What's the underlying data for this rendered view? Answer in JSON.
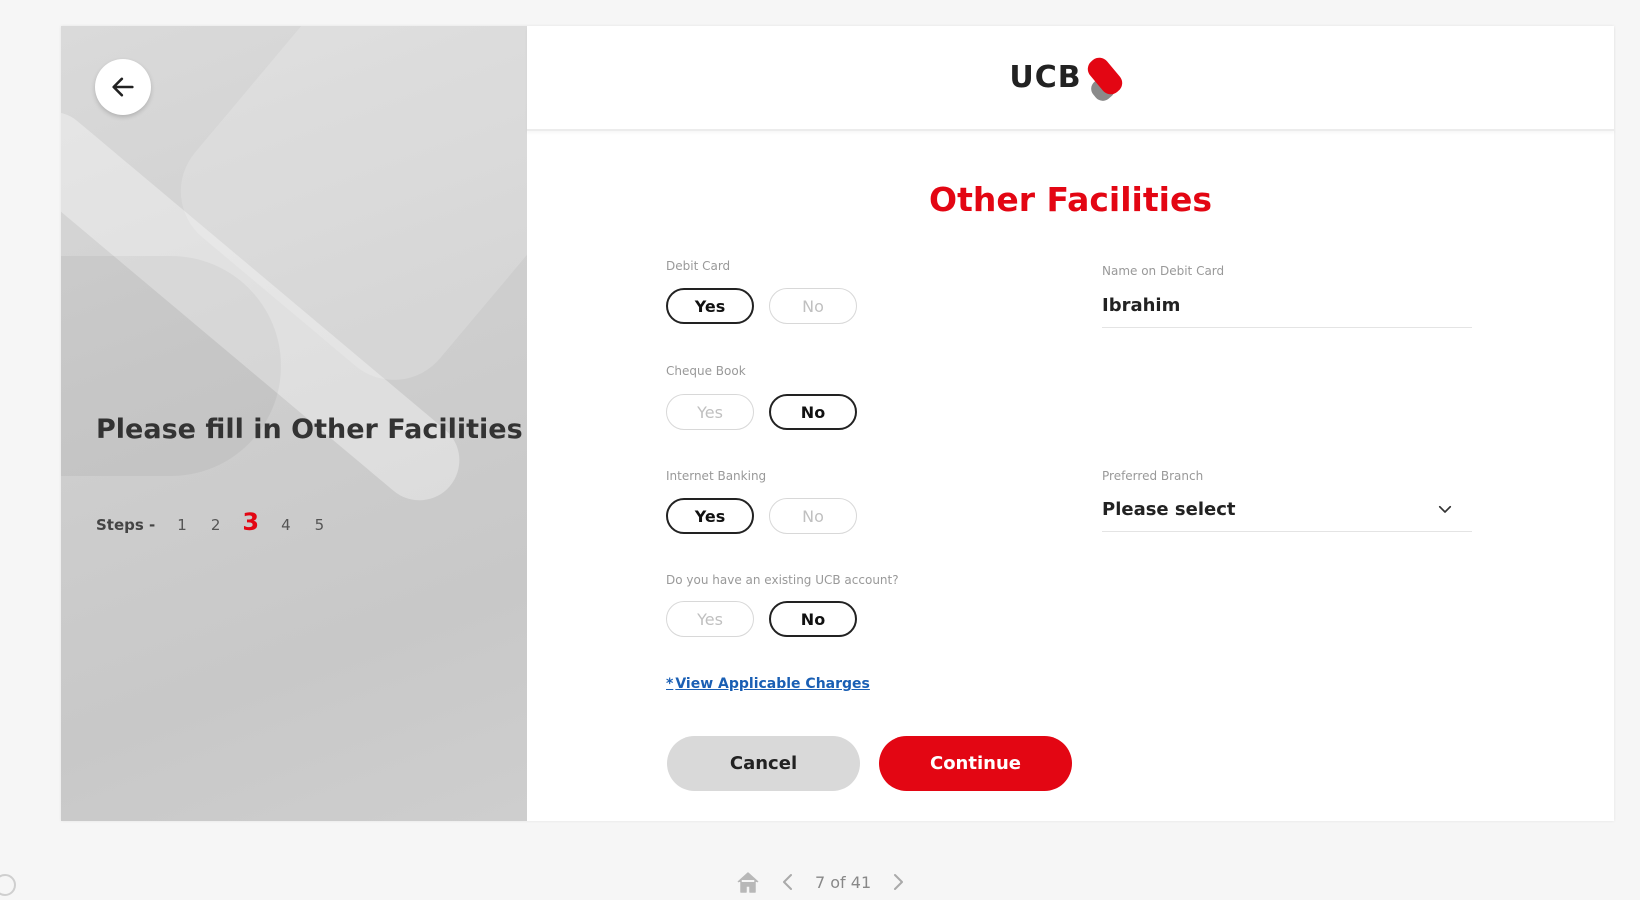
{
  "left_panel": {
    "title": "Please fill in Other Facilities",
    "steps_label": "Steps -",
    "steps": [
      "1",
      "2",
      "3",
      "4",
      "5"
    ],
    "active_step": "3",
    "back_icon": "arrow-left-icon"
  },
  "header": {
    "logo_text": "UCB",
    "logo_icon": "ucb-logo-mark-icon"
  },
  "form": {
    "title": "Other Facilities",
    "debit_card": {
      "label": "Debit Card",
      "yes": "Yes",
      "no": "No",
      "selected": "Yes"
    },
    "name_on_debit_card": {
      "label": "Name on Debit Card",
      "value": "Ibrahim"
    },
    "cheque_book": {
      "label": "Cheque Book",
      "yes": "Yes",
      "no": "No",
      "selected": "No"
    },
    "internet_banking": {
      "label": "Internet Banking",
      "yes": "Yes",
      "no": "No",
      "selected": "Yes"
    },
    "preferred_branch": {
      "label": "Preferred Branch",
      "value": "Please select",
      "icon": "chevron-down-icon"
    },
    "existing_account": {
      "label": "Do you have an existing UCB account?",
      "yes": "Yes",
      "no": "No",
      "selected": "No"
    },
    "charges_link": "View Applicable Charges",
    "cancel_label": "Cancel",
    "continue_label": "Continue"
  },
  "pager": {
    "text": "7 of 41",
    "home_icon": "home-icon",
    "prev_icon": "chevron-left-icon",
    "next_icon": "chevron-right-icon"
  },
  "colors": {
    "accent": "#e30613",
    "link": "#1a5fb4",
    "cancel_bg": "#d9d9d9"
  }
}
